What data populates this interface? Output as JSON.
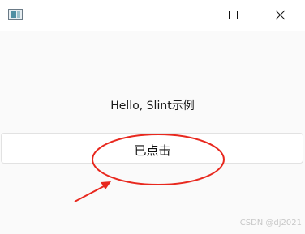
{
  "window": {
    "icon": "app-window-icon",
    "controls": {
      "minimize_icon": "minimize-icon",
      "maximize_icon": "maximize-icon",
      "close_icon": "close-icon"
    }
  },
  "content": {
    "greeting": "Hello, Slint示例",
    "button_label": "已点击"
  },
  "annotation": {
    "color": "#e8281e",
    "shapes": [
      "ellipse",
      "arrow"
    ]
  },
  "watermark": "CSDN @dj2021",
  "colors": {
    "background": "#fafafa",
    "titlebar": "#ffffff",
    "button_border": "#e2e2e2"
  }
}
